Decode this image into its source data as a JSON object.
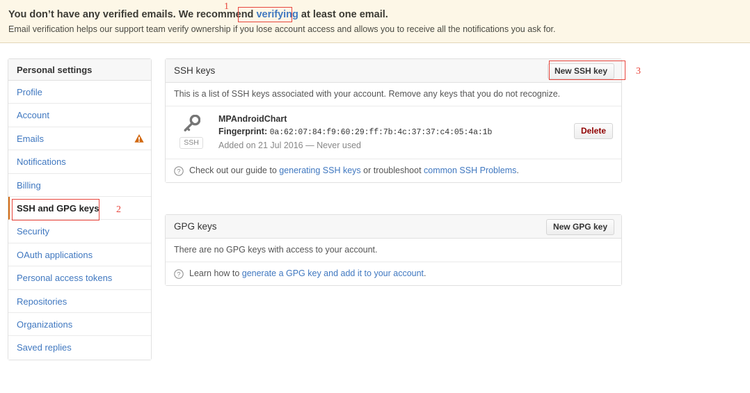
{
  "banner": {
    "line1_before": "You don’t have any verified emails. We recommend ",
    "line1_link": "verifying",
    "line1_after": " at least one email.",
    "line2": "Email verification helps our support team verify ownership if you lose account access and allows you to receive all the notifications you ask for.",
    "background_color": "#fdf7e7",
    "border_color": "#e3d6b8"
  },
  "sidebar": {
    "heading": "Personal settings",
    "items": [
      {
        "label": "Profile",
        "active": false,
        "warning": false
      },
      {
        "label": "Account",
        "active": false,
        "warning": false
      },
      {
        "label": "Emails",
        "active": false,
        "warning": true
      },
      {
        "label": "Notifications",
        "active": false,
        "warning": false
      },
      {
        "label": "Billing",
        "active": false,
        "warning": false
      },
      {
        "label": "SSH and GPG keys",
        "active": true,
        "warning": false
      },
      {
        "label": "Security",
        "active": false,
        "warning": false
      },
      {
        "label": "OAuth applications",
        "active": false,
        "warning": false
      },
      {
        "label": "Personal access tokens",
        "active": false,
        "warning": false
      },
      {
        "label": "Repositories",
        "active": false,
        "warning": false
      },
      {
        "label": "Organizations",
        "active": false,
        "warning": false
      },
      {
        "label": "Saved replies",
        "active": false,
        "warning": false
      }
    ],
    "warning_icon_color": "#d26911",
    "active_marker_color": "#d26911",
    "link_color": "#4078c0"
  },
  "ssh_panel": {
    "title": "SSH keys",
    "new_button": "New SSH key",
    "description": "This is a list of SSH keys associated with your account. Remove any keys that you do not recognize.",
    "key": {
      "icon": "key-icon",
      "badge": "SSH",
      "title": "MPAndroidChart",
      "fingerprint_label": "Fingerprint:",
      "fingerprint_value": "0a:62:07:84:f9:60:29:ff:7b:4c:37:37:c4:05:4a:1b",
      "meta": "Added on 21 Jul 2016 — Never used",
      "delete_button": "Delete"
    },
    "help": {
      "before": "Check out our guide to ",
      "link1": "generating SSH keys",
      "middle": " or troubleshoot ",
      "link2": "common SSH Problems",
      "after": "."
    }
  },
  "gpg_panel": {
    "title": "GPG keys",
    "new_button": "New GPG key",
    "empty_text": "There are no GPG keys with access to your account.",
    "help": {
      "before": "Learn how to ",
      "link1": "generate a GPG key and add it to your account",
      "after": "."
    }
  },
  "annotations": {
    "color": "#e8453c",
    "markers": [
      {
        "number": "1",
        "target": "verifying-link"
      },
      {
        "number": "2",
        "target": "sidebar-item-ssh-and-gpg-keys"
      },
      {
        "number": "3",
        "target": "new-ssh-key-button"
      }
    ]
  }
}
